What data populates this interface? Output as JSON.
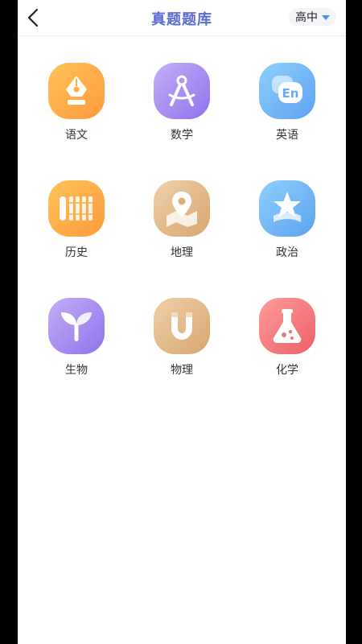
{
  "header": {
    "title": "真题题库",
    "level": "高中"
  },
  "subjects": [
    {
      "label": "语文",
      "icon": "pen-nib-icon"
    },
    {
      "label": "数学",
      "icon": "compass-icon"
    },
    {
      "label": "英语",
      "icon": "en-bubble-icon"
    },
    {
      "label": "历史",
      "icon": "bamboo-scroll-icon"
    },
    {
      "label": "地理",
      "icon": "map-pin-icon"
    },
    {
      "label": "政治",
      "icon": "star-icon"
    },
    {
      "label": "生物",
      "icon": "sprout-icon"
    },
    {
      "label": "物理",
      "icon": "magnet-icon"
    },
    {
      "label": "化学",
      "icon": "flask-icon"
    }
  ],
  "colors": {
    "title": "#5b6bd0",
    "orange": "#ffb04a",
    "purple": "#a58af0",
    "blue": "#6fb1f5",
    "tan": "#e0b78a",
    "red": "#f07a78"
  }
}
